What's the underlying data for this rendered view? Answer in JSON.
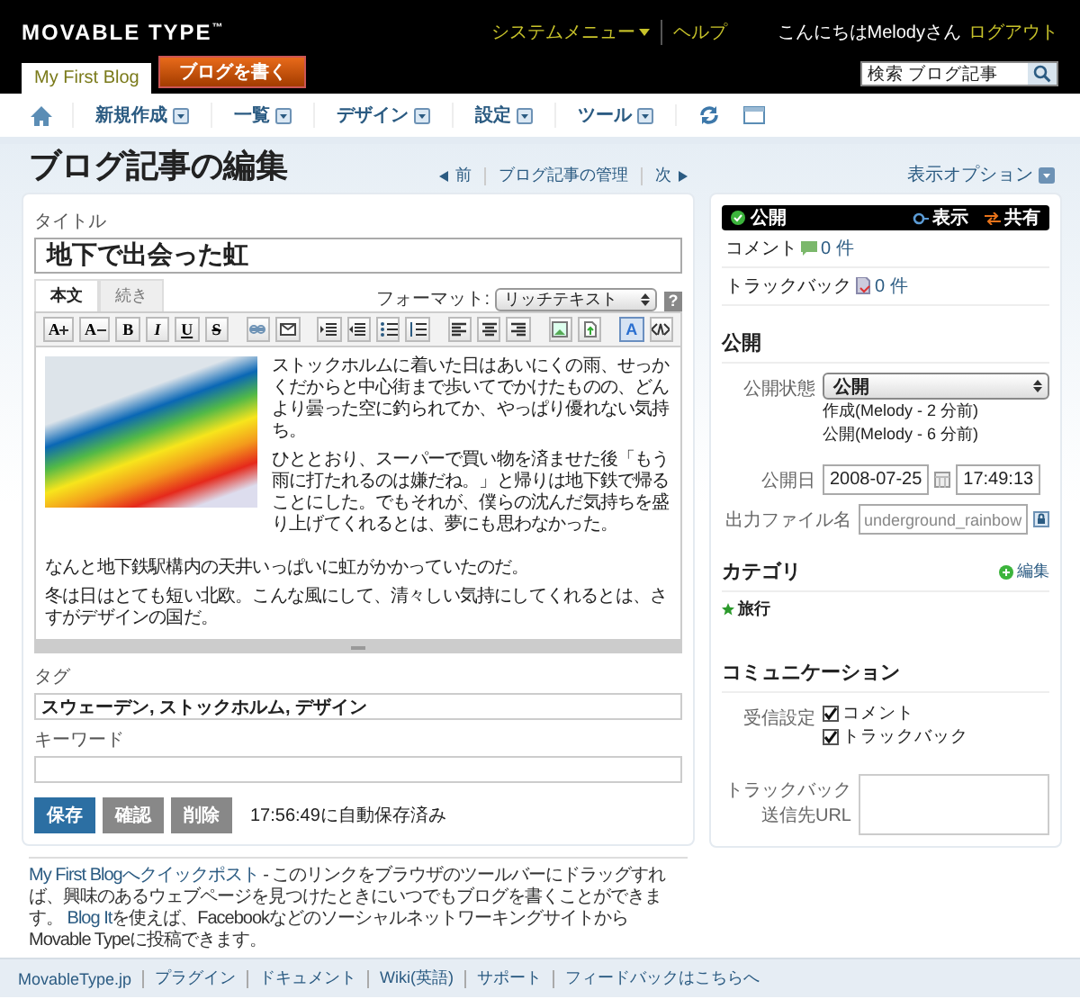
{
  "header": {
    "logo": "MOVABLE TYPE",
    "logo_mark": "™",
    "system_menu": "システムメニュー",
    "help": "ヘルプ",
    "greeting": "こんにちはMelodyさん",
    "logout": "ログアウト",
    "blog_tabs": [
      {
        "label": "My First Blog",
        "selected": true
      }
    ],
    "write_button": "ブログを書く",
    "search": {
      "value": "検索 ブログ記事"
    }
  },
  "nav": [
    "新規作成",
    "一覧",
    "デザイン",
    "設定",
    "ツール"
  ],
  "page": {
    "title": "ブログ記事の編集",
    "prev": "前",
    "manage": "ブログ記事の管理",
    "next": "次",
    "display_options": "表示オプション"
  },
  "entry": {
    "title_label": "タイトル",
    "title": "地下で出会った虹",
    "editor_tabs": [
      {
        "label": "本文",
        "selected": true
      },
      {
        "label": "続き",
        "selected": false
      }
    ],
    "format_label": "フォーマット:",
    "format": "リッチテキスト",
    "help": "?",
    "toolbar_font": [
      "A",
      "A"
    ],
    "toolbar_letters": [
      "B",
      "I",
      "U",
      "S"
    ],
    "toolbar_color": "A",
    "body_side": [
      "ストックホルムに着いた日はあいにくの雨、せっかくだからと中心街まで歩いてでかけたものの、どんより曇った空に釣られてか、やっぱり優れない気持ち。",
      "ひととおり、スーパーで買い物を済ませた後「もう雨に打たれるのは嫌だね。」と帰りは地下鉄で帰ることにした。でもそれが、僕らの沈んだ気持ちを盛り上げてくれるとは、夢にも思わなかった。"
    ],
    "body": [
      "なんと地下鉄駅構内の天井いっぱいに虹がかかっていたのだ。",
      "冬は日はとても短い北欧。こんな風にして、清々しい気持にしてくれるとは、さすがデザインの国だ。"
    ]
  },
  "tags": {
    "label": "タグ",
    "value": "スウェーデン, ストックホルム, デザイン"
  },
  "keywords": {
    "label": "キーワード"
  },
  "buttons": [
    {
      "label": "保存",
      "kind": "primary"
    },
    {
      "label": "確認",
      "kind": "secondary"
    },
    {
      "label": "削除",
      "kind": "secondary"
    }
  ],
  "autosave": "17:56:49に自動保存済み",
  "quickpost": {
    "link": "My First Blogへクイックポスト",
    "text1": " - このリンクをブラウザのツールバーにドラッグすれば、興味のあるウェブページを見つけたときにいつでもブログを書くことができます。 ",
    "link2": "Blog It",
    "text2": "を使えば、FacebookなどのソーシャルネットワーキングサイトからMovable Typeに投稿できます。"
  },
  "status_panel": {
    "status": "公開",
    "view": "表示",
    "share": "共有",
    "comments_label": "コメント",
    "comments": "0 件",
    "trackbacks_label": "トラックバック",
    "trackbacks": "0 件"
  },
  "publish": {
    "heading": "公開",
    "status_label": "公開状態",
    "status": "公開",
    "created": "作成(Melody - 2 分前)",
    "published": "公開(Melody - 6 分前)",
    "date_label": "公開日",
    "date": "2008-07-25",
    "time": "17:49:13",
    "file_label": "出力ファイル名",
    "file": "underground_rainbow"
  },
  "categories": {
    "heading": "カテゴリ",
    "edit": "編集",
    "items": [
      "旅行"
    ]
  },
  "communication": {
    "heading": "コミュニケーション",
    "accept_label": "受信設定",
    "options": [
      {
        "label": "コメント",
        "checked": true
      },
      {
        "label": "トラックバック",
        "checked": true
      }
    ],
    "trackback_label": "トラックバック送信先URL"
  },
  "footer": [
    "MovableType.jp",
    "プラグイン",
    "ドキュメント",
    "Wiki(英語)",
    "サポート",
    "フィードバックはこちらへ"
  ]
}
